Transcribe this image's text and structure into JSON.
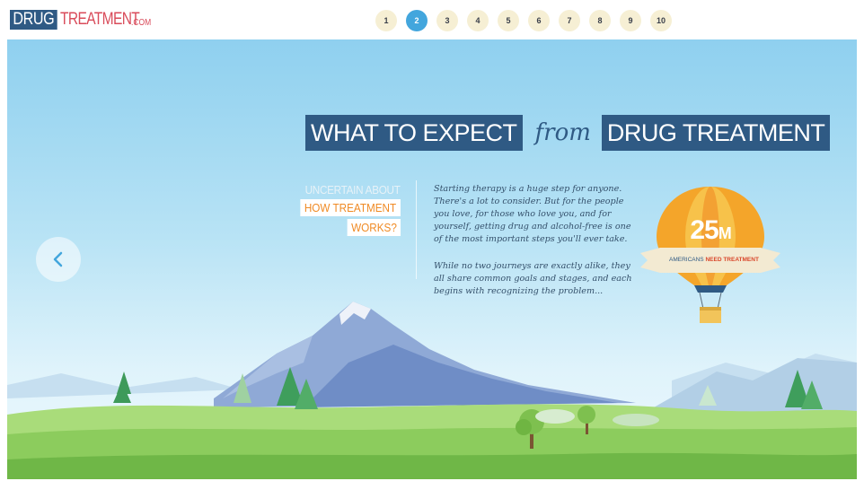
{
  "header": {
    "logo": {
      "part1": "DRUG",
      "part2": "TREATMENT",
      "part3": ".COM"
    },
    "pages": [
      "1",
      "2",
      "3",
      "4",
      "5",
      "6",
      "7",
      "8",
      "9",
      "10"
    ],
    "active_page": "2"
  },
  "hero": {
    "headline": {
      "left": "WHAT TO EXPECT",
      "middle": "from",
      "right": "DRUG TREATMENT"
    },
    "side_question": {
      "line1": "UNCERTAIN ABOUT",
      "line2": "HOW TREATMENT",
      "line3": "WORKS?"
    },
    "paragraphs": [
      "Starting therapy is a huge step for anyone. There's a lot to consider. But for the people you love, for those who love you, and for yourself, getting drug and alcohol-free is one of the most important steps you'll ever take.",
      "While no two journeys are exactly alike, they all share common goals and stages, and each begins with recognizing the problem..."
    ],
    "stat": {
      "number": "25",
      "unit": "M",
      "banner_prefix": "AMERICANS",
      "banner_emph": "NEED TREATMENT"
    }
  },
  "nav": {
    "prev_icon": "chevron-left-icon"
  },
  "colors": {
    "navy": "#2f5a84",
    "accent_blue": "#43a6dd",
    "orange": "#f08a24",
    "logo_red": "#d94b5a"
  }
}
